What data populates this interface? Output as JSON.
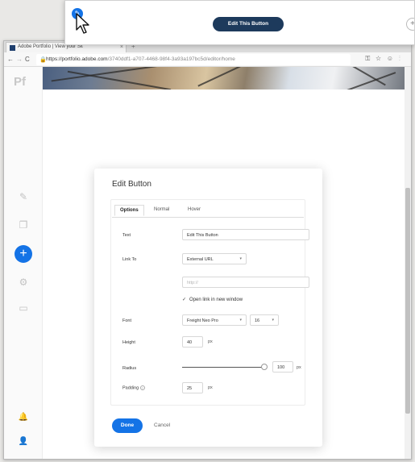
{
  "browser": {
    "tab_title": "Adobe Portfolio | View your Sit",
    "tab_close": "×",
    "tab_new": "+",
    "nav_back": "←",
    "nav_forward": "→",
    "nav_reload": "C",
    "lock_icon": "🔒",
    "url_host": "https://portfolio.adobe.com",
    "url_path": "/3740ddf1-a707-4468-98f4-3a93a197bc5d/editor/home",
    "toolbar_icons": "⚿☆☺⋮"
  },
  "sidebar": {
    "logo": "Pf",
    "pen_icon": "✎",
    "pages_icon": "❐",
    "add_icon": "+",
    "settings_icon": "⚙",
    "layout_icon": "▭",
    "bell_icon": "🔔",
    "user_icon": "👤"
  },
  "modal": {
    "title": "Edit Button",
    "tabs": [
      "Options",
      "Normal",
      "Hover"
    ],
    "text_label": "Text",
    "text_value": "Edit This Button",
    "link_label": "Link To",
    "link_value": "External URL",
    "url_placeholder": "http://",
    "new_window_label": "Open link in new window",
    "font_label": "Font",
    "font_value": "Freight Neo Pro",
    "font_size": "16",
    "height_label": "Height",
    "height_value": "40",
    "radius_label": "Radius",
    "radius_value": "100",
    "padding_label": "Padding",
    "padding_value": "25",
    "px_unit": "px",
    "done_label": "Done",
    "cancel_label": "Cancel"
  },
  "callout": {
    "button_label": "Edit This Button",
    "edit_icon": "✎",
    "plus_icon": "+"
  }
}
